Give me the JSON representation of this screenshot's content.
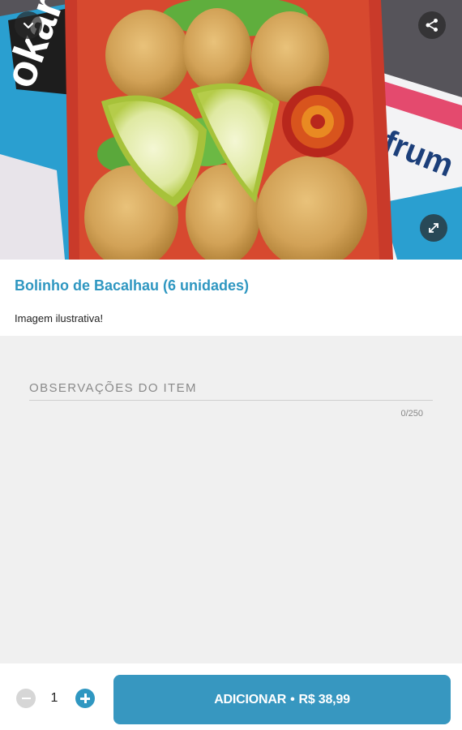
{
  "product": {
    "image_alt": "Bolinho de Bacalhau",
    "name": "Bolinho de Bacalhau (6 unidades)",
    "description": "Imagem ilustrativa!"
  },
  "hero": {
    "brand_text_left": "okar",
    "brand_text_right": "frum",
    "icons": {
      "back": "chevron-down-icon",
      "share": "share-icon",
      "expand": "expand-icon"
    }
  },
  "observations": {
    "placeholder": "OBSERVAÇÕES DO ITEM",
    "value": "",
    "counter": "0/250"
  },
  "cart": {
    "quantity": "1",
    "add_label": "ADICIONAR",
    "separator": "•",
    "price": "R$ 38,99"
  },
  "colors": {
    "accent": "#2f97c1",
    "button": "#3797c0",
    "background": "#f0f0f0"
  }
}
